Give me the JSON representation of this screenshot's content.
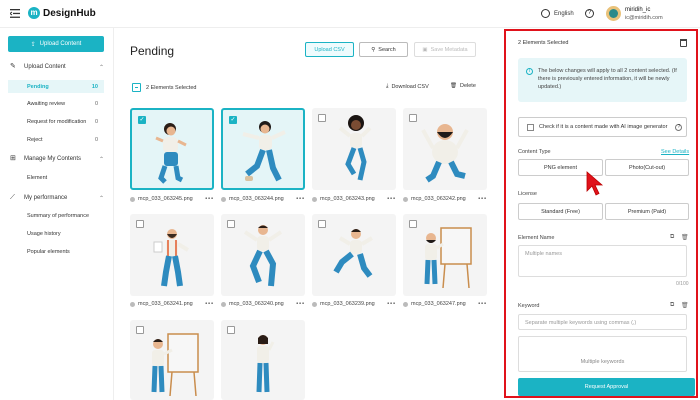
{
  "header": {
    "logo_letter": "m",
    "logo_text": "DesignHub",
    "language": "English",
    "user_name": "miridih_ic",
    "user_email": "ic@miridih.com"
  },
  "sidebar": {
    "upload_button": "Upload Content",
    "sections": [
      {
        "label": "Upload Content",
        "items": [
          {
            "label": "Pending",
            "count": "10"
          },
          {
            "label": "Awaiting review",
            "count": "0"
          },
          {
            "label": "Request for modification",
            "count": "0"
          },
          {
            "label": "Reject",
            "count": "0"
          }
        ]
      },
      {
        "label": "Manage My Contents",
        "items": [
          {
            "label": "Element"
          }
        ]
      },
      {
        "label": "My performance",
        "items": [
          {
            "label": "Summary of performance"
          },
          {
            "label": "Usage history"
          },
          {
            "label": "Popular elements"
          }
        ]
      }
    ]
  },
  "main": {
    "title": "Pending",
    "upload_csv": "Upload CSV",
    "search": "Search",
    "save_metadata": "Save Metadata",
    "selected_text": "2 Elements Selected",
    "download_csv": "Download CSV",
    "delete": "Delete",
    "cards": [
      {
        "file": "mcp_033_063245.png",
        "checked": true
      },
      {
        "file": "mcp_033_063244.png",
        "checked": true
      },
      {
        "file": "mcp_033_063243.png",
        "checked": false
      },
      {
        "file": "mcp_033_063242.png",
        "checked": false
      },
      {
        "file": "mcp_033_063241.png",
        "checked": false
      },
      {
        "file": "mcp_033_063240.png",
        "checked": false
      },
      {
        "file": "mcp_033_063239.png",
        "checked": false
      },
      {
        "file": "mcp_033_063247.png",
        "checked": false
      },
      {
        "file": "",
        "checked": false
      },
      {
        "file": "",
        "checked": false
      }
    ],
    "more": "•••"
  },
  "panel": {
    "selected_text": "2 Elements Selected",
    "info_text": "The below changes will apply to all 2 content selected. (If there is previously entered information, it will be newly updated.)",
    "ai_check": "Check if it is a content made with AI image generator",
    "content_type_label": "Content Type",
    "see_details": "See Details",
    "content_type_options": [
      "PNG element",
      "Photo(Cut-out)"
    ],
    "license_label": "License",
    "license_options": [
      "Standard (Free)",
      "Premium (Paid)"
    ],
    "element_name_label": "Element Name",
    "element_name_placeholder": "Multiple names",
    "element_name_counter": "0/100",
    "keyword_label": "Keyword",
    "keyword_placeholder": "Separate multiple keywords using commas (,)",
    "keyword_area_text": "Multiple keywords",
    "request_button": "Request Approval"
  },
  "colors": {
    "accent": "#1bb3c4",
    "highlight_border": "#e0121b",
    "pointer": "#e0121b"
  }
}
